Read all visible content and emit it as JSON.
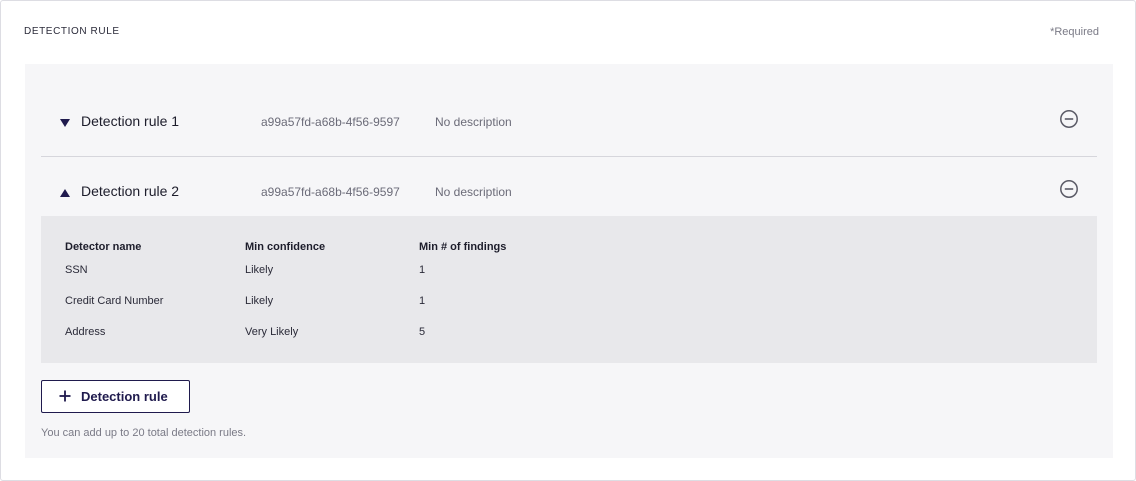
{
  "section": {
    "title": "DETECTION RULE",
    "required": "*Required"
  },
  "rules": [
    {
      "name": "Detection rule 1",
      "id": "a99a57fd-a68b-4f56-9597",
      "description": "No description",
      "expanded": false
    },
    {
      "name": "Detection rule 2",
      "id": "a99a57fd-a68b-4f56-9597",
      "description": "No description",
      "expanded": true
    }
  ],
  "detectors": {
    "headers": [
      "Detector name",
      "Min confidence",
      "Min # of findings"
    ],
    "rows": [
      [
        "SSN",
        "Likely",
        "1"
      ],
      [
        "Credit Card Number",
        "Likely",
        "1"
      ],
      [
        "Address",
        "Very Likely",
        "5"
      ]
    ]
  },
  "add_button": {
    "label": "Detection rule"
  },
  "hint": "You can add up to 20 total detection rules.",
  "colors": {
    "accent": "#1f1a4d",
    "panel": "#f6f6f8",
    "details": "#e8e8eb"
  },
  "icons": {
    "collapsed": "triangle-down-icon",
    "expanded": "triangle-up-icon",
    "remove": "minus-circle-icon",
    "add": "plus-icon"
  }
}
